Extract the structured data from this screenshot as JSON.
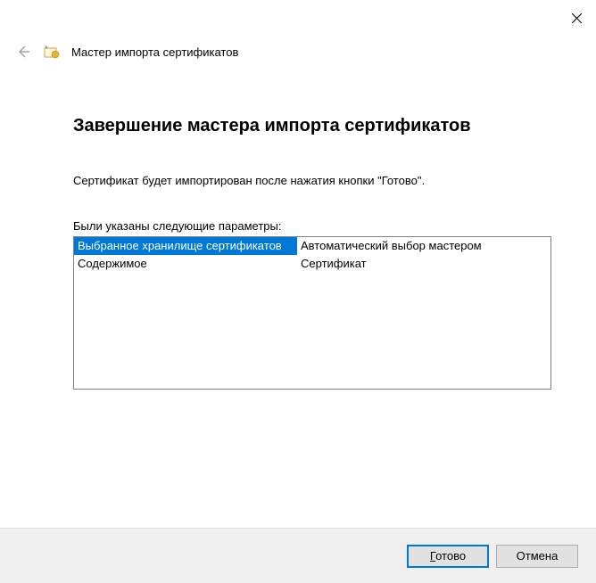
{
  "window": {
    "wizard_title": "Мастер импорта сертификатов"
  },
  "main": {
    "heading": "Завершение мастера импорта сертификатов",
    "description": "Сертификат будет импортирован после нажатия кнопки \"Готово\".",
    "params_label": "Были указаны следующие параметры:",
    "params": [
      {
        "name": "Выбранное хранилище сертификатов",
        "value": "Автоматический выбор мастером",
        "selected": true
      },
      {
        "name": "Содержимое",
        "value": "Сертификат",
        "selected": false
      }
    ]
  },
  "footer": {
    "finish_prefix": "Г",
    "finish_rest": "отово",
    "cancel": "Отмена"
  }
}
